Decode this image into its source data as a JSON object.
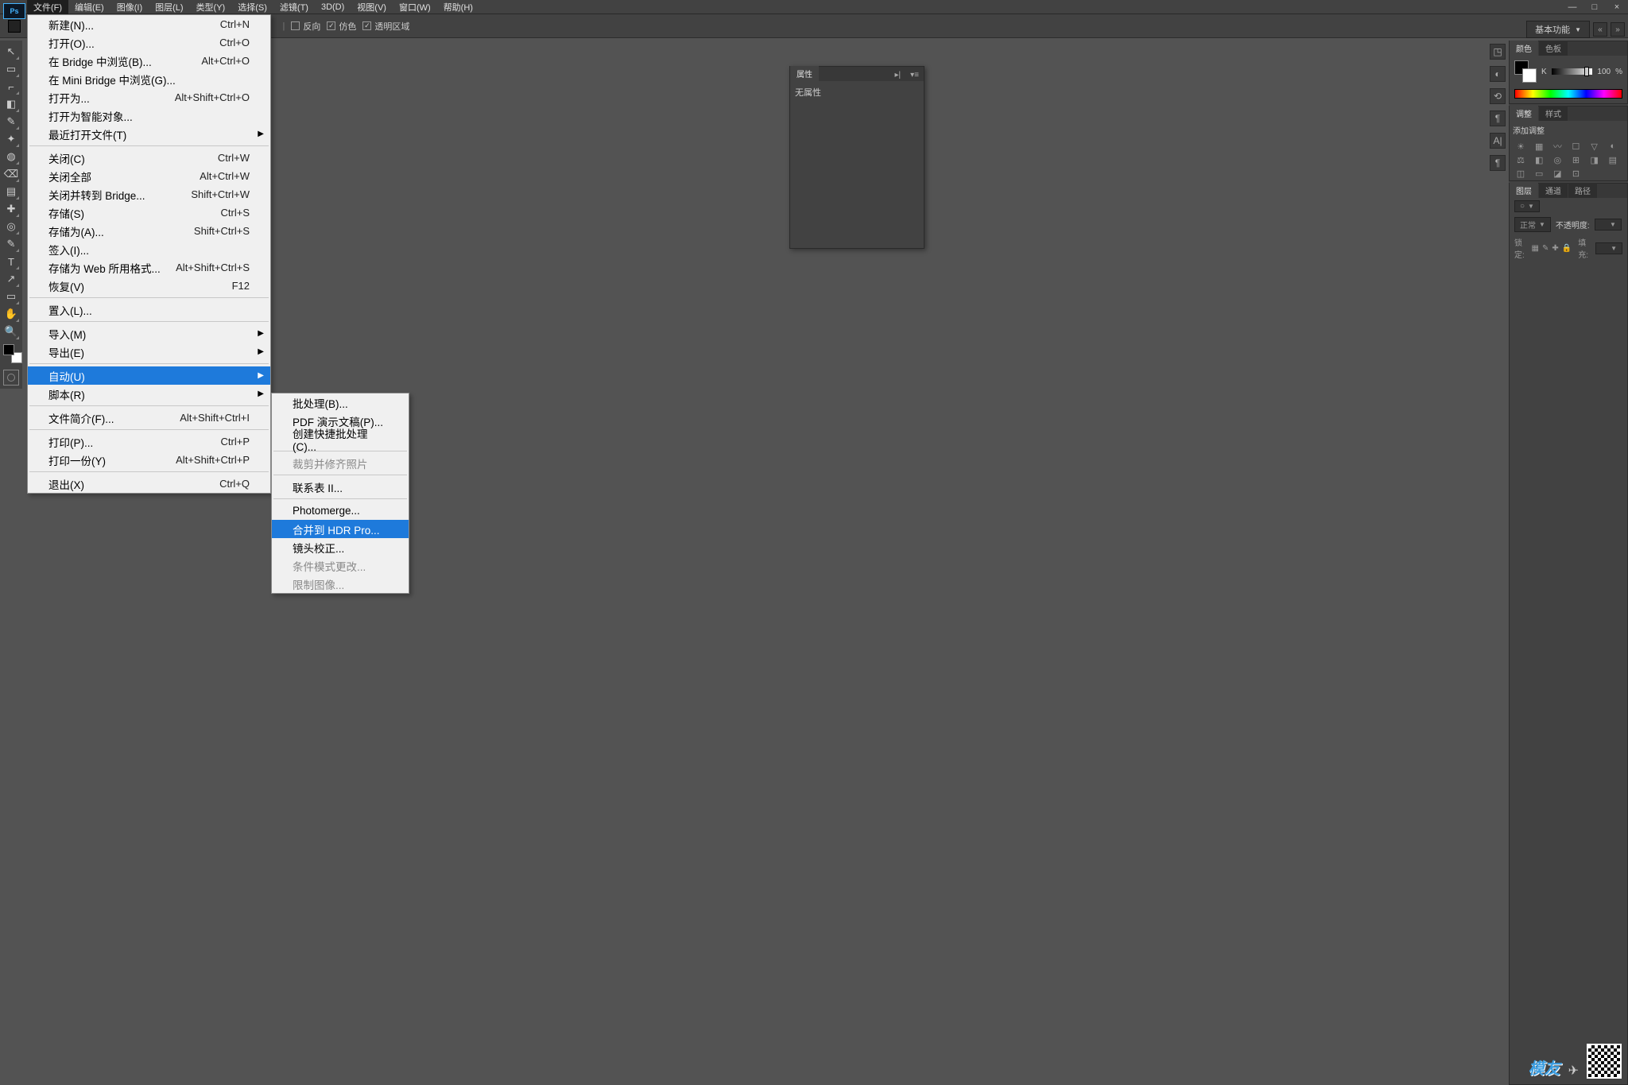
{
  "app": {
    "abbr": "Ps"
  },
  "menubar": [
    "文件(F)",
    "编辑(E)",
    "图像(I)",
    "图层(L)",
    "类型(Y)",
    "选择(S)",
    "滤镜(T)",
    "3D(D)",
    "视图(V)",
    "窗口(W)",
    "帮助(H)"
  ],
  "window_controls": {
    "min": "—",
    "max": "□",
    "close": "×"
  },
  "optionsbar": {
    "reverse": "反向",
    "dither": "仿色",
    "transparent": "透明区域"
  },
  "workspace": {
    "label": "基本功能",
    "nav_prev": "«",
    "nav_next": "»"
  },
  "file_menu": [
    {
      "t": "item",
      "label": "新建(N)...",
      "sc": "Ctrl+N"
    },
    {
      "t": "item",
      "label": "打开(O)...",
      "sc": "Ctrl+O"
    },
    {
      "t": "item",
      "label": "在 Bridge 中浏览(B)...",
      "sc": "Alt+Ctrl+O"
    },
    {
      "t": "item",
      "label": "在 Mini Bridge 中浏览(G)..."
    },
    {
      "t": "item",
      "label": "打开为...",
      "sc": "Alt+Shift+Ctrl+O"
    },
    {
      "t": "item",
      "label": "打开为智能对象..."
    },
    {
      "t": "item",
      "label": "最近打开文件(T)",
      "sub": true
    },
    {
      "t": "sep"
    },
    {
      "t": "item",
      "label": "关闭(C)",
      "sc": "Ctrl+W"
    },
    {
      "t": "item",
      "label": "关闭全部",
      "sc": "Alt+Ctrl+W"
    },
    {
      "t": "item",
      "label": "关闭并转到 Bridge...",
      "sc": "Shift+Ctrl+W"
    },
    {
      "t": "item",
      "label": "存储(S)",
      "sc": "Ctrl+S"
    },
    {
      "t": "item",
      "label": "存储为(A)...",
      "sc": "Shift+Ctrl+S"
    },
    {
      "t": "item",
      "label": "签入(I)..."
    },
    {
      "t": "item",
      "label": "存储为 Web 所用格式...",
      "sc": "Alt+Shift+Ctrl+S"
    },
    {
      "t": "item",
      "label": "恢复(V)",
      "sc": "F12"
    },
    {
      "t": "sep"
    },
    {
      "t": "item",
      "label": "置入(L)..."
    },
    {
      "t": "sep"
    },
    {
      "t": "item",
      "label": "导入(M)",
      "sub": true
    },
    {
      "t": "item",
      "label": "导出(E)",
      "sub": true
    },
    {
      "t": "sep"
    },
    {
      "t": "item",
      "label": "自动(U)",
      "sub": true,
      "hl": true
    },
    {
      "t": "item",
      "label": "脚本(R)",
      "sub": true
    },
    {
      "t": "sep"
    },
    {
      "t": "item",
      "label": "文件简介(F)...",
      "sc": "Alt+Shift+Ctrl+I"
    },
    {
      "t": "sep"
    },
    {
      "t": "item",
      "label": "打印(P)...",
      "sc": "Ctrl+P"
    },
    {
      "t": "item",
      "label": "打印一份(Y)",
      "sc": "Alt+Shift+Ctrl+P"
    },
    {
      "t": "sep"
    },
    {
      "t": "item",
      "label": "退出(X)",
      "sc": "Ctrl+Q"
    }
  ],
  "sub_menu": [
    {
      "t": "item",
      "label": "批处理(B)..."
    },
    {
      "t": "item",
      "label": "PDF 演示文稿(P)..."
    },
    {
      "t": "item",
      "label": "创建快捷批处理(C)..."
    },
    {
      "t": "sep"
    },
    {
      "t": "item",
      "label": "裁剪并修齐照片",
      "disabled": true
    },
    {
      "t": "sep"
    },
    {
      "t": "item",
      "label": "联系表 II..."
    },
    {
      "t": "sep"
    },
    {
      "t": "item",
      "label": "Photomerge..."
    },
    {
      "t": "item",
      "label": "合并到 HDR Pro...",
      "hl": true
    },
    {
      "t": "item",
      "label": "镜头校正..."
    },
    {
      "t": "item",
      "label": "条件模式更改...",
      "disabled": true
    },
    {
      "t": "item",
      "label": "限制图像...",
      "disabled": true
    }
  ],
  "properties_panel": {
    "tab": "属性",
    "body": "无属性"
  },
  "panels": {
    "color": {
      "tab_active": "颜色",
      "tab2": "色板",
      "letter": "K",
      "value": "100",
      "pct": "%"
    },
    "adjustments": {
      "tab_active": "调整",
      "tab2": "样式",
      "heading": "添加调整"
    },
    "layers": {
      "tab_active": "图层",
      "tab2": "通道",
      "tab3": "路径",
      "mode": "正常",
      "opacity_label": "不透明度:",
      "lock_label": "锁定:",
      "fill_label": "填充:"
    }
  },
  "tools": [
    "↖",
    "▭",
    "⌐",
    "◧",
    "✎",
    "✦",
    "◍",
    "⌫",
    "▤",
    "✚",
    "◎",
    "✎",
    "T",
    "↗",
    "▭",
    "✋",
    "🔍"
  ],
  "dock_icons": [
    "◳",
    "◐",
    "⟲",
    "¶",
    "A|",
    "¶"
  ],
  "watermark": {
    "text": "模友"
  }
}
